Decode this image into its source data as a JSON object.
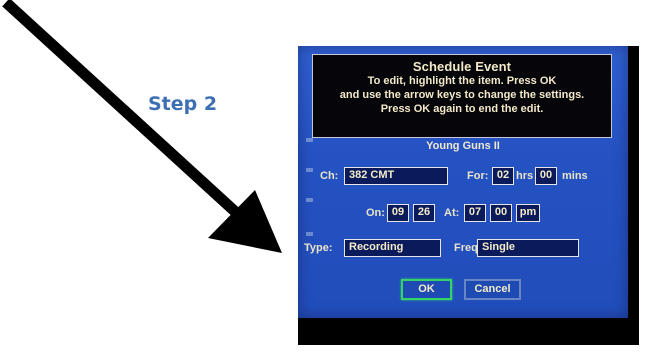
{
  "step_label": "Step 2",
  "dialog": {
    "title": "Schedule Event",
    "instructions": [
      "To edit, highlight the item. Press OK",
      "and use the arrow keys to change the settings.",
      "Press OK again to end the edit."
    ],
    "program_name": "Young Guns II",
    "channel": {
      "label": "Ch:",
      "value": "382 CMT"
    },
    "duration": {
      "label": "For:",
      "hours": "02",
      "hours_label": "hrs",
      "minutes": "00",
      "minutes_label": "mins"
    },
    "date": {
      "label": "On:",
      "month": "09",
      "day": "26"
    },
    "time": {
      "label": "At:",
      "hour": "07",
      "minute": "00",
      "ampm": "pm"
    },
    "type": {
      "label": "Type:",
      "value": "Recording"
    },
    "frequency": {
      "label": "Freq:",
      "value": "Single"
    },
    "buttons": {
      "ok": "OK",
      "cancel": "Cancel"
    }
  },
  "colors": {
    "step_text": "#3d6fb3",
    "screen_blue": "#2552c2",
    "field_bg": "#0b1a5a",
    "highlight_green": "#34d267"
  },
  "icons": [
    "arrow-pointer-icon"
  ]
}
